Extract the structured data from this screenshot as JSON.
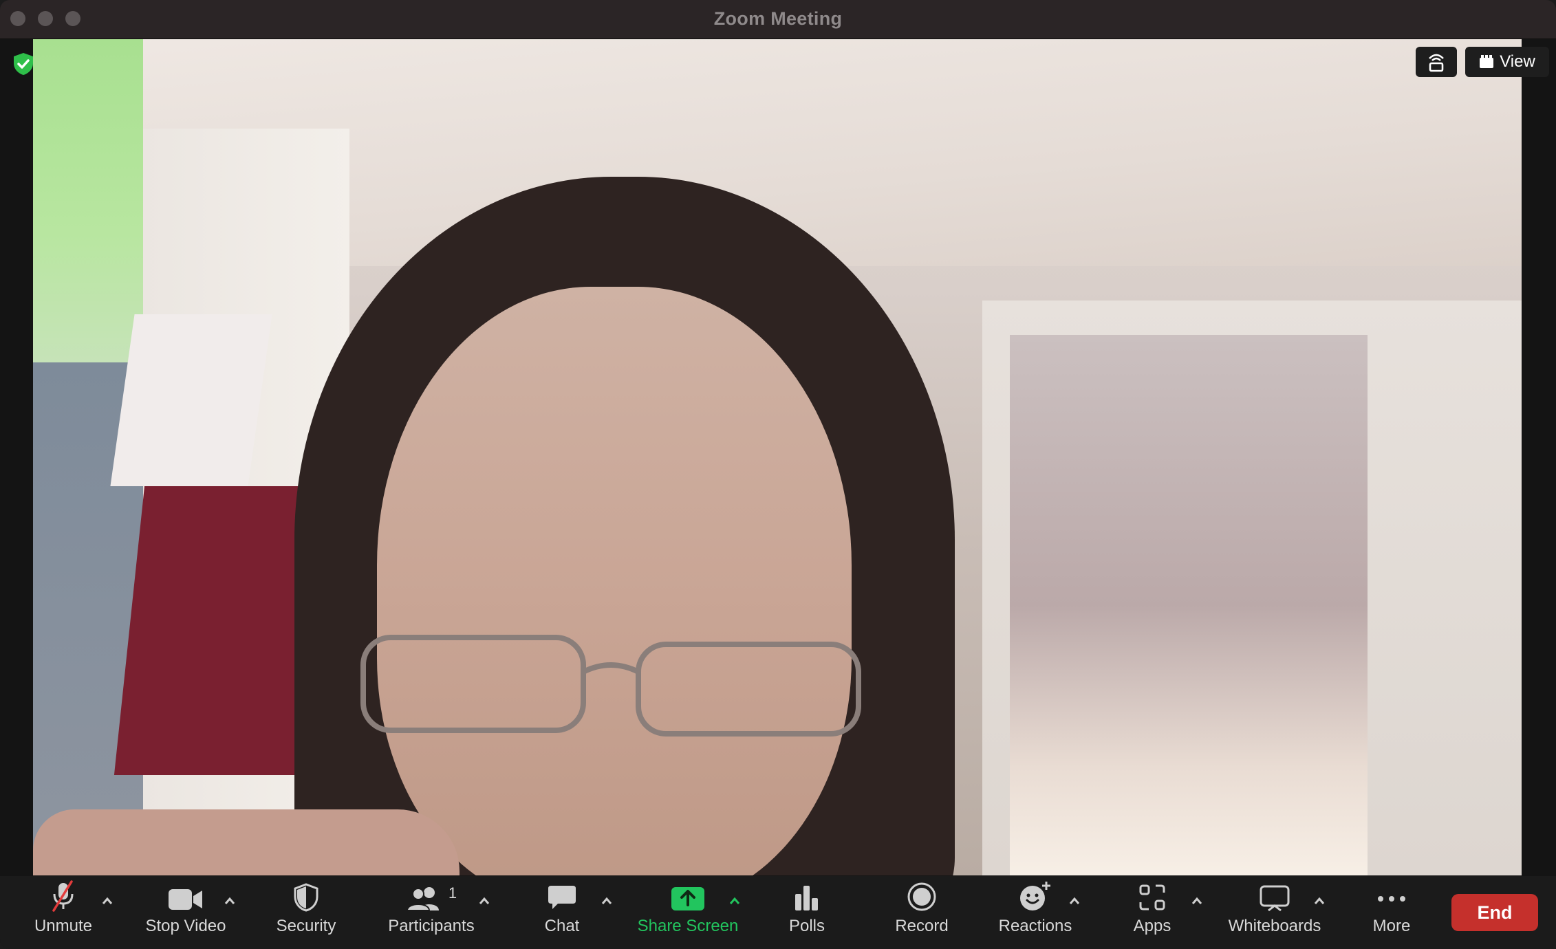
{
  "window": {
    "title": "Zoom Meeting"
  },
  "video_overlay": {
    "view_label": "View"
  },
  "toolbar": {
    "unmute_label": "Unmute",
    "stop_video_label": "Stop Video",
    "security_label": "Security",
    "participants_label": "Participants",
    "participants_count": "1",
    "chat_label": "Chat",
    "share_screen_label": "Share Screen",
    "polls_label": "Polls",
    "record_label": "Record",
    "reactions_label": "Reactions",
    "apps_label": "Apps",
    "whiteboards_label": "Whiteboards",
    "more_label": "More",
    "end_label": "End"
  },
  "colors": {
    "share_screen_green": "#22c55e",
    "end_red": "#c5302c",
    "shield_green": "#2fbf4a",
    "muted_red": "#e23b3b"
  }
}
